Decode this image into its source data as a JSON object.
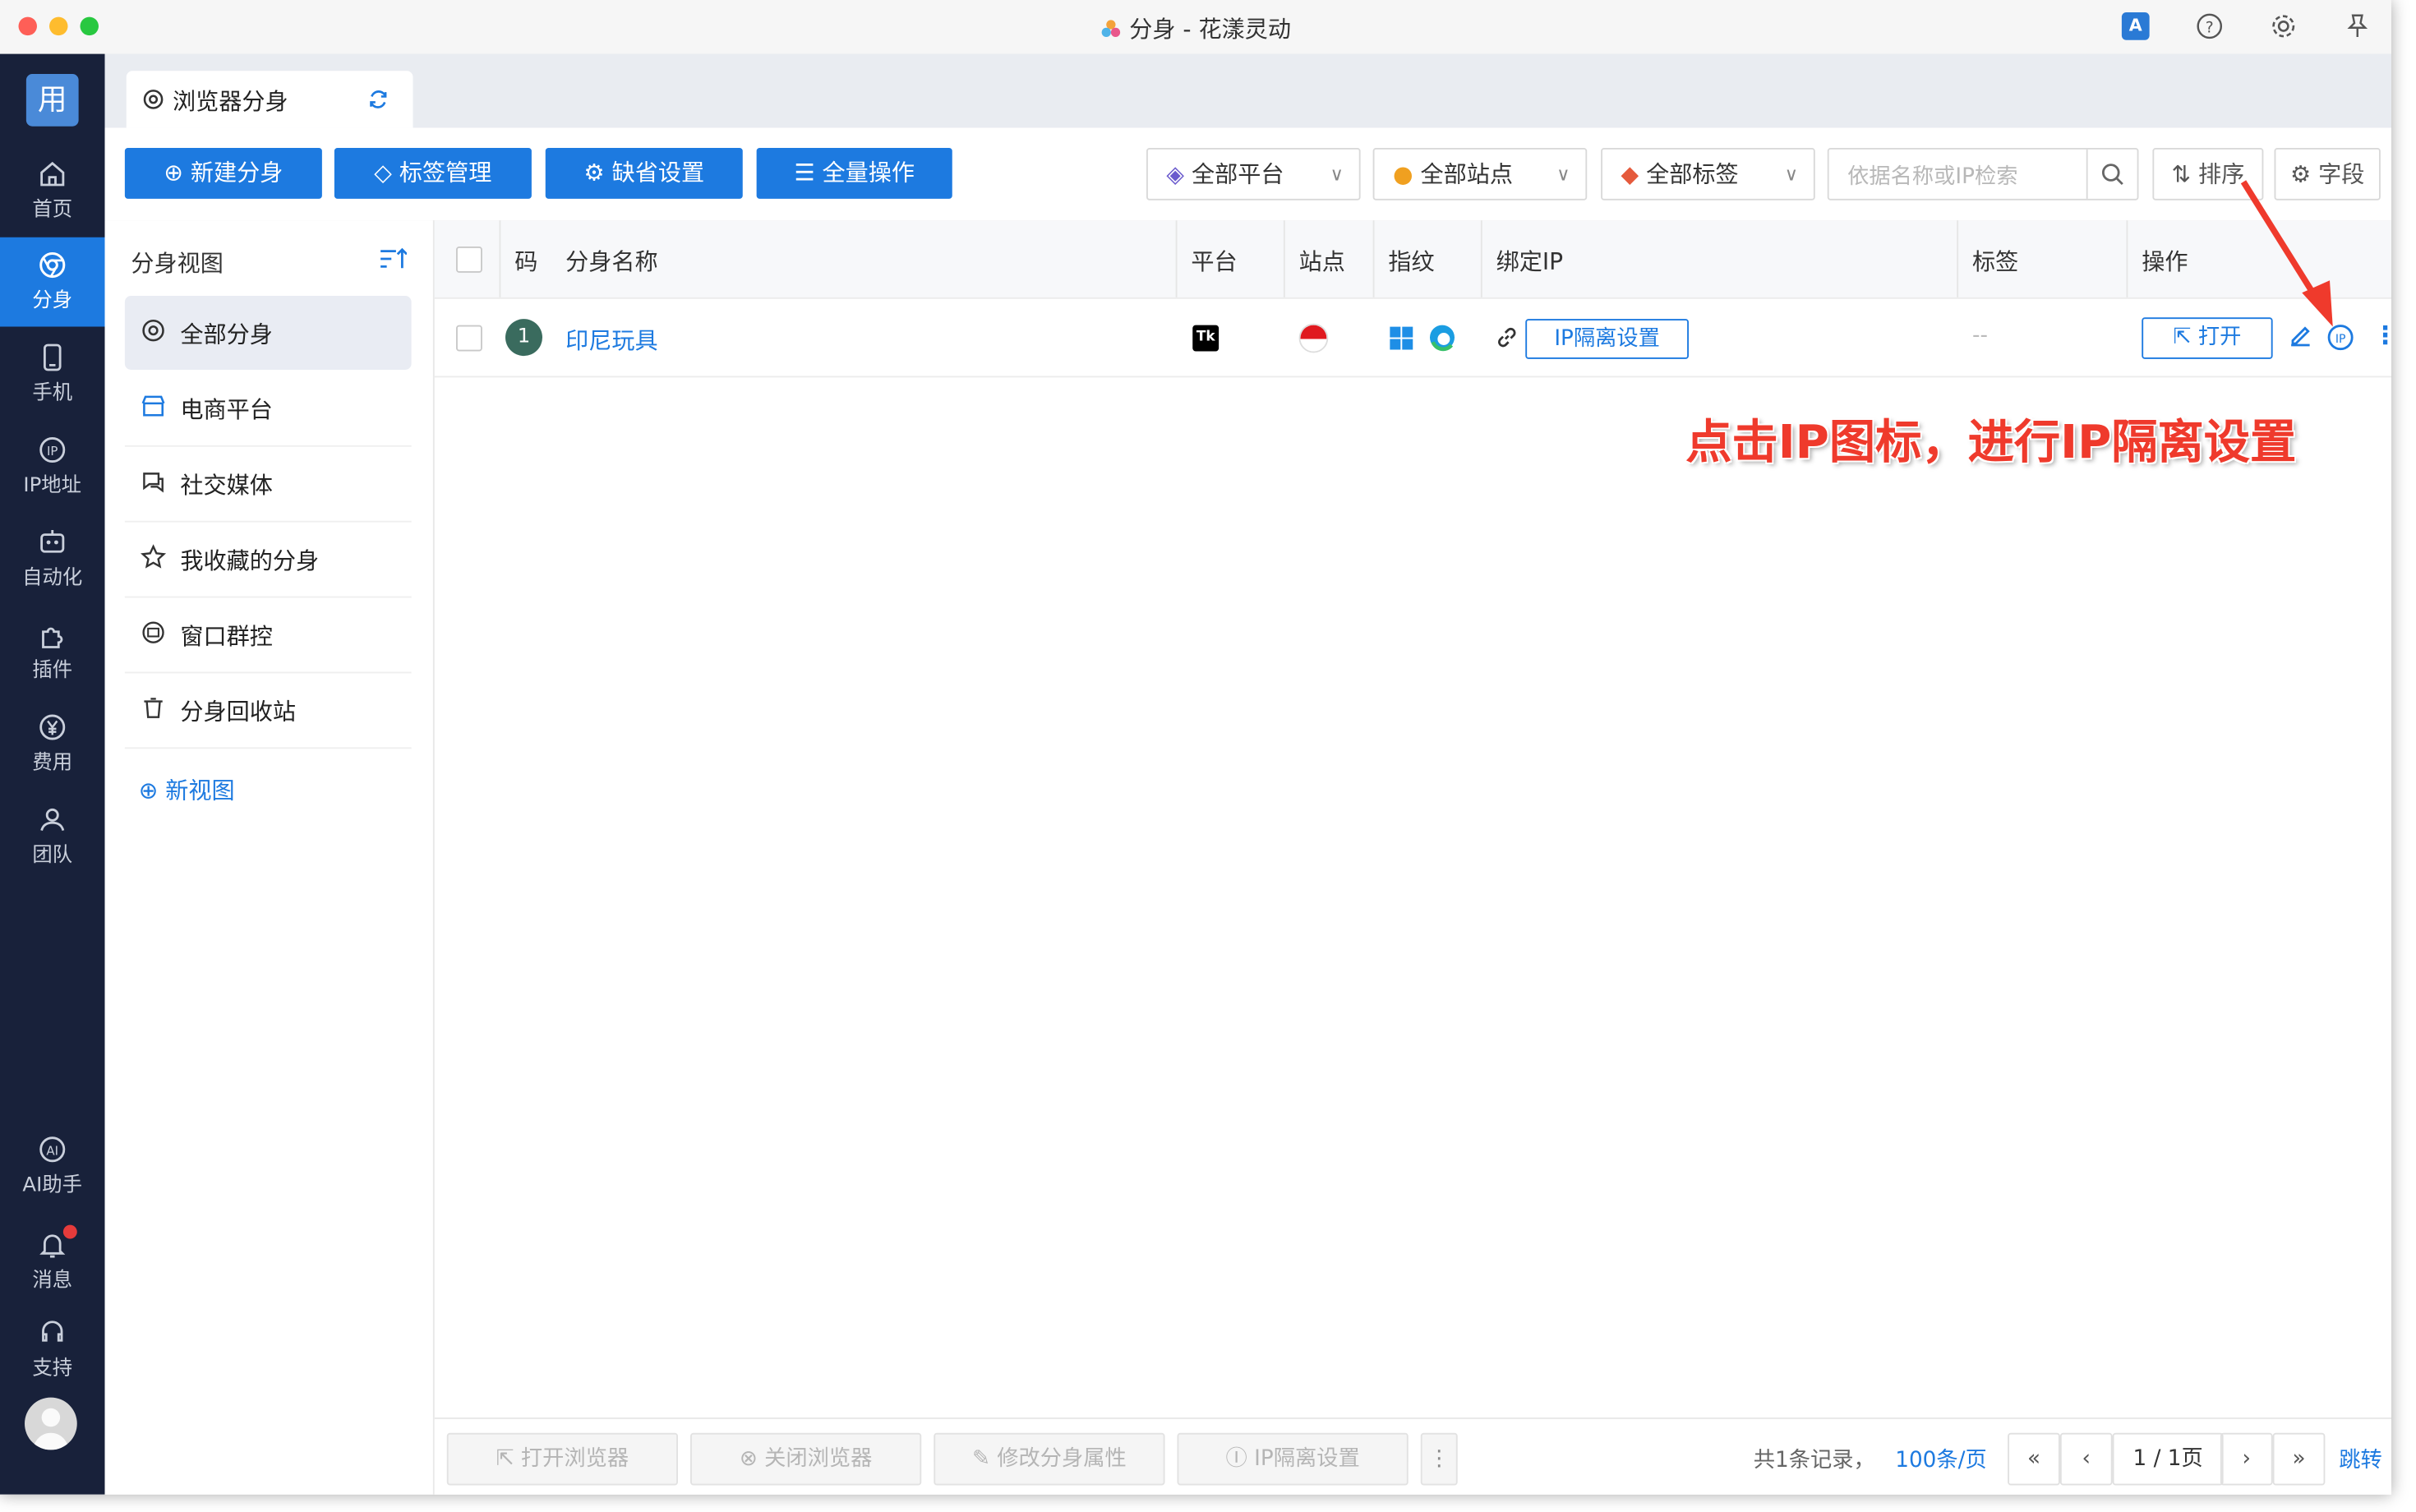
{
  "window": {
    "title": "分身 - 花漾灵动"
  },
  "sidebar": {
    "logo": "用",
    "items": [
      {
        "label": "首页",
        "icon": "home-icon"
      },
      {
        "label": "分身",
        "icon": "browser-profile-icon"
      },
      {
        "label": "手机",
        "icon": "phone-icon"
      },
      {
        "label": "IP地址",
        "icon": "ip-icon"
      },
      {
        "label": "自动化",
        "icon": "robot-icon"
      },
      {
        "label": "插件",
        "icon": "puzzle-icon"
      },
      {
        "label": "费用",
        "icon": "yen-icon"
      },
      {
        "label": "团队",
        "icon": "team-icon"
      }
    ],
    "bottom_items": [
      {
        "label": "AI助手",
        "icon": "ai-icon"
      },
      {
        "label": "消息",
        "icon": "bell-icon"
      },
      {
        "label": "支持",
        "icon": "headset-icon"
      }
    ]
  },
  "tabs": {
    "active_label": "浏览器分身"
  },
  "toolbar": {
    "new_profile": "新建分身",
    "tag_manage": "标签管理",
    "default_settings": "缺省设置",
    "bulk_ops": "全量操作",
    "platform_filter": "全部平台",
    "site_filter": "全部站点",
    "tag_filter": "全部标签",
    "search_placeholder": "依据名称或IP检索",
    "sort": "排序",
    "fields": "字段"
  },
  "views": {
    "title": "分身视图",
    "items": [
      "全部分身",
      "电商平台",
      "社交媒体",
      "我收藏的分身",
      "窗口群控",
      "分身回收站"
    ],
    "new_view": "新视图"
  },
  "table": {
    "columns": [
      "码",
      "分身名称",
      "平台",
      "站点",
      "指纹",
      "绑定IP",
      "标签",
      "操作"
    ],
    "rows": [
      {
        "num": "1",
        "name": "印尼玩具",
        "platform_badge": "Tk",
        "ip_button": "IP隔离设置",
        "tags": "--",
        "open_label": "打开"
      }
    ]
  },
  "annotation": "点击IP图标，进行IP隔离设置",
  "footer": {
    "open_browser": "打开浏览器",
    "close_browser": "关闭浏览器",
    "edit_attrs": "修改分身属性",
    "ip_isolation": "IP隔离设置",
    "total": "共1条记录，",
    "page_size": "100条/页",
    "page_info": "1 / 1页",
    "jump": "跳转"
  },
  "colors": {
    "accent": "#1d7ae0",
    "sidebar_bg": "#18213a",
    "annotation": "#ef3a2c"
  }
}
